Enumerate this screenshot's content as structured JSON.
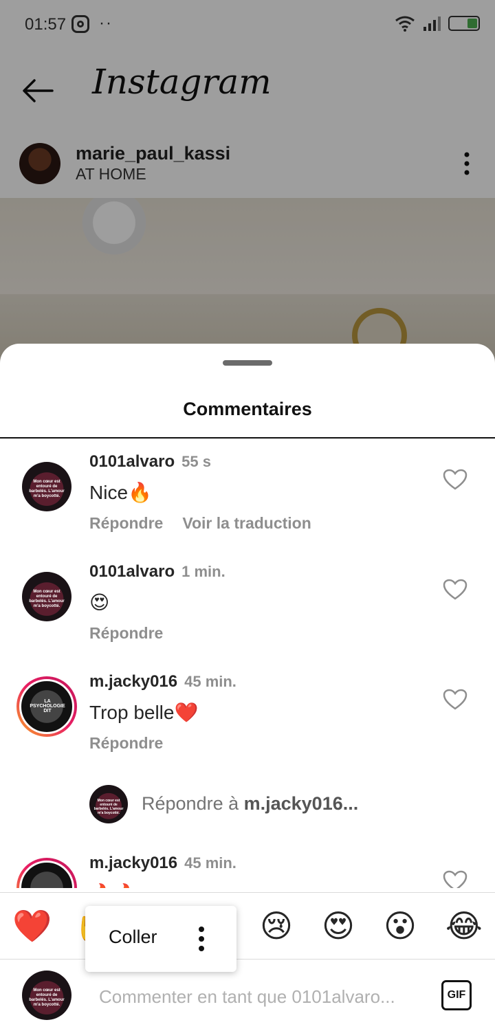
{
  "status_bar": {
    "time": "01:57",
    "dots": "··"
  },
  "app_header": {
    "title": "Instagram"
  },
  "post": {
    "username": "marie_paul_kassi",
    "location": "AT HOME"
  },
  "comments_sheet": {
    "title": "Commentaires",
    "comments": [
      {
        "username": "0101alvaro",
        "time": "55 s",
        "text": "Nice🔥",
        "reply_label": "Répondre",
        "translate_label": "Voir la traduction",
        "avatar_text": "Mon cœur est entouré de barbelés. L'amour m'a boycotté."
      },
      {
        "username": "0101alvaro",
        "time": "1 min.",
        "text": "😍",
        "reply_label": "Répondre",
        "avatar_text": "Mon cœur est entouré de barbelés. L'amour m'a boycotté."
      },
      {
        "username": "m.jacky016",
        "time": "45 min.",
        "text": "Trop belle❤️",
        "reply_label": "Répondre",
        "avatar_text": "LA PSYCHOLOGIE DIT"
      },
      {
        "username": "m.jacky016",
        "time": "45 min.",
        "text": "🔥🔥",
        "avatar_text": ""
      }
    ],
    "reply_prompt": {
      "prefix": "Répondre à ",
      "target": "m.jacky016..."
    }
  },
  "emoji_bar": {
    "emojis": [
      "❤️",
      "✋",
      "😢",
      "😍",
      "😮",
      "😂"
    ]
  },
  "paste_popup": {
    "label": "Coller"
  },
  "composer": {
    "placeholder": "Commenter en tant que 0101alvaro...",
    "gif_label": "GIF"
  }
}
